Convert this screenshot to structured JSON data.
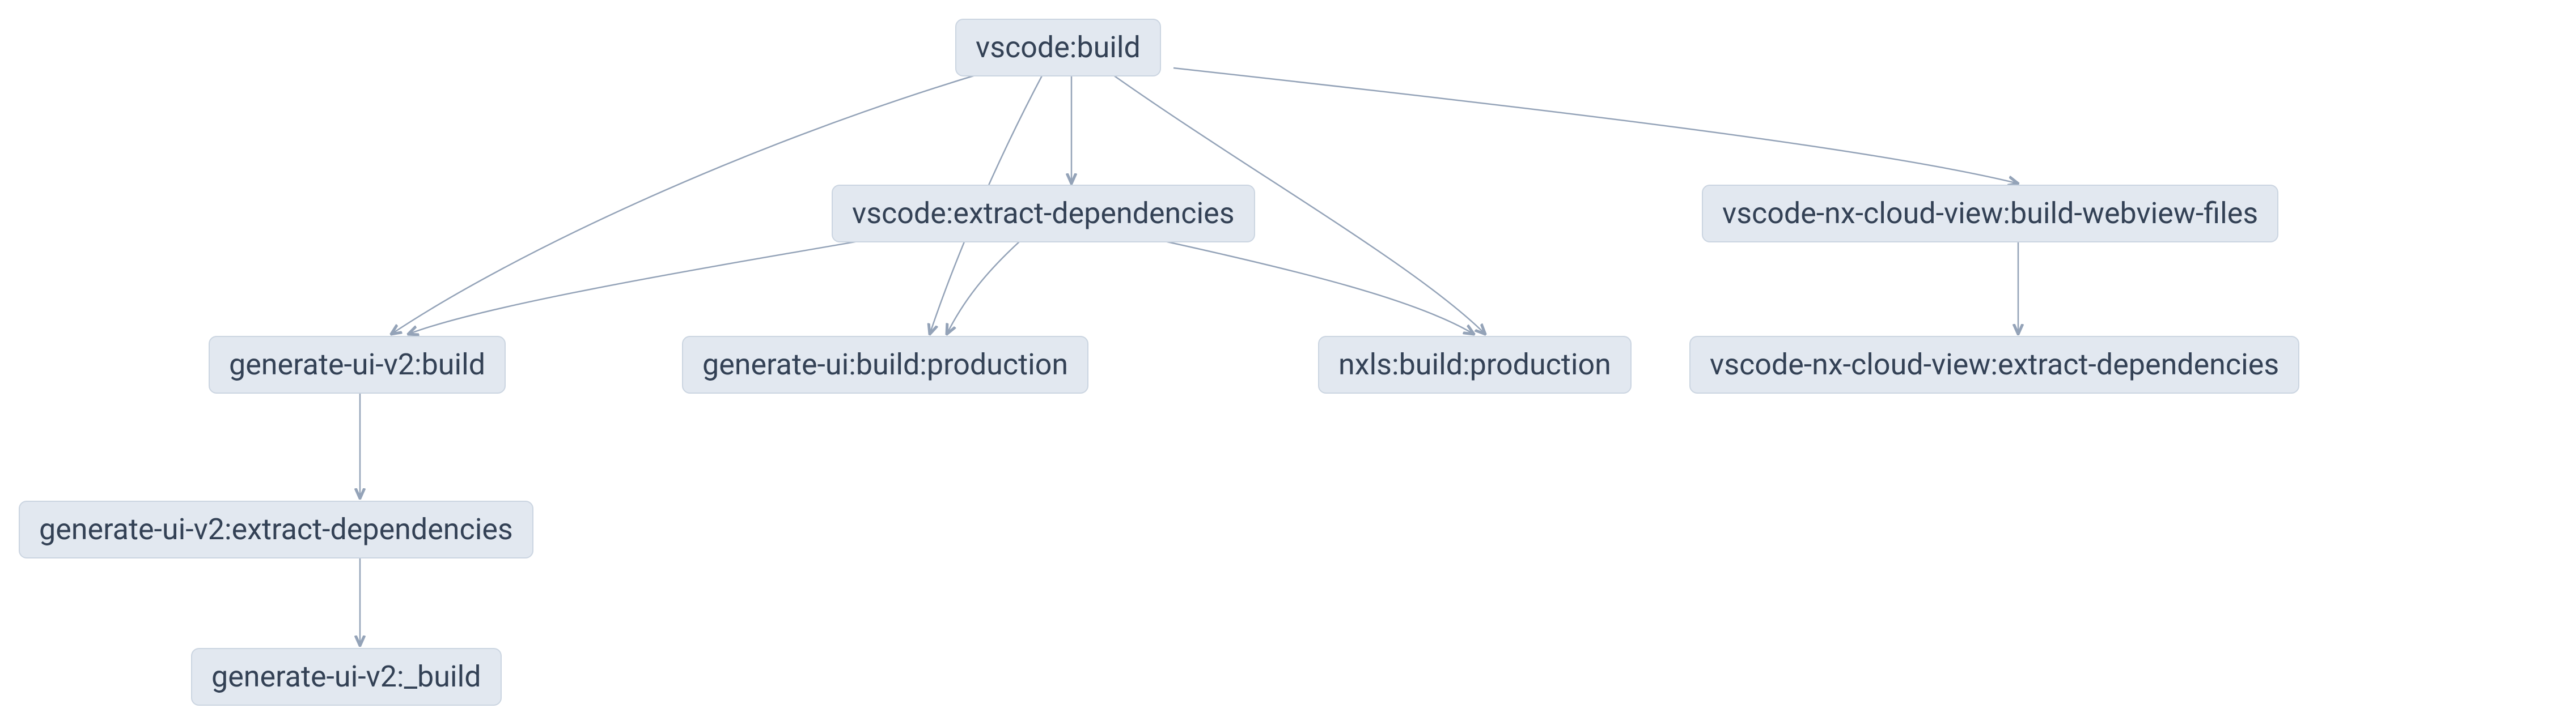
{
  "diagram": {
    "nodes": {
      "root": "vscode:build",
      "extract": "vscode:extract-dependencies",
      "cloud_webview": "vscode-nx-cloud-view:build-webview-files",
      "gen_v2_build": "generate-ui-v2:build",
      "gen_build_prod": "generate-ui:build:production",
      "nxls_build_prod": "nxls:build:production",
      "cloud_extract": "vscode-nx-cloud-view:extract-dependencies",
      "gen_v2_extract": "generate-ui-v2:extract-dependencies",
      "gen_v2_underscore": "generate-ui-v2:_build"
    },
    "edges": [
      [
        "root",
        "extract"
      ],
      [
        "root",
        "cloud_webview"
      ],
      [
        "root",
        "gen_v2_build"
      ],
      [
        "root",
        "gen_build_prod"
      ],
      [
        "root",
        "nxls_build_prod"
      ],
      [
        "extract",
        "gen_v2_build"
      ],
      [
        "extract",
        "gen_build_prod"
      ],
      [
        "extract",
        "nxls_build_prod"
      ],
      [
        "cloud_webview",
        "cloud_extract"
      ],
      [
        "gen_v2_build",
        "gen_v2_extract"
      ],
      [
        "gen_v2_extract",
        "gen_v2_underscore"
      ]
    ],
    "colors": {
      "node_bg": "#e2e8f0",
      "node_border": "#cbd5e1",
      "text": "#334155",
      "edge": "#94a3b8"
    }
  }
}
